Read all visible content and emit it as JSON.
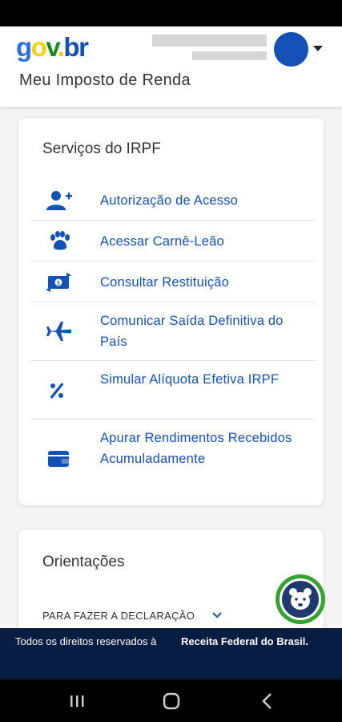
{
  "header": {
    "logo": {
      "g": "g",
      "o": "o",
      "v": "v",
      "dot": ".",
      "br": "br"
    },
    "app_title": "Meu Imposto de Renda"
  },
  "services": {
    "title": "Serviços do IRPF",
    "items": [
      {
        "icon": "user-add-icon",
        "label": "Autorização de Acesso"
      },
      {
        "icon": "paw-icon",
        "label": "Acessar Carnê-Leão"
      },
      {
        "icon": "money-exchange-icon",
        "label": "Consultar Restituição"
      },
      {
        "icon": "airplane-icon",
        "label": "Comunicar Saída Definitiva do País"
      },
      {
        "icon": "percent-icon",
        "label": "Simular Alíquota Efetiva IRPF"
      },
      {
        "icon": "wallet-icon",
        "label": "Apurar Rendimentos Recebidos Acumuladamente"
      }
    ]
  },
  "orientations": {
    "title": "Orientações",
    "link": "PARA FAZER A DECLARAÇÃO"
  },
  "footer": {
    "left": "Todos os direitos reservados à",
    "right": "Receita Federal do Brasil."
  },
  "colors": {
    "primary": "#1351b4",
    "footer_bg": "#071d41",
    "assistant_ring": "#36a330"
  }
}
